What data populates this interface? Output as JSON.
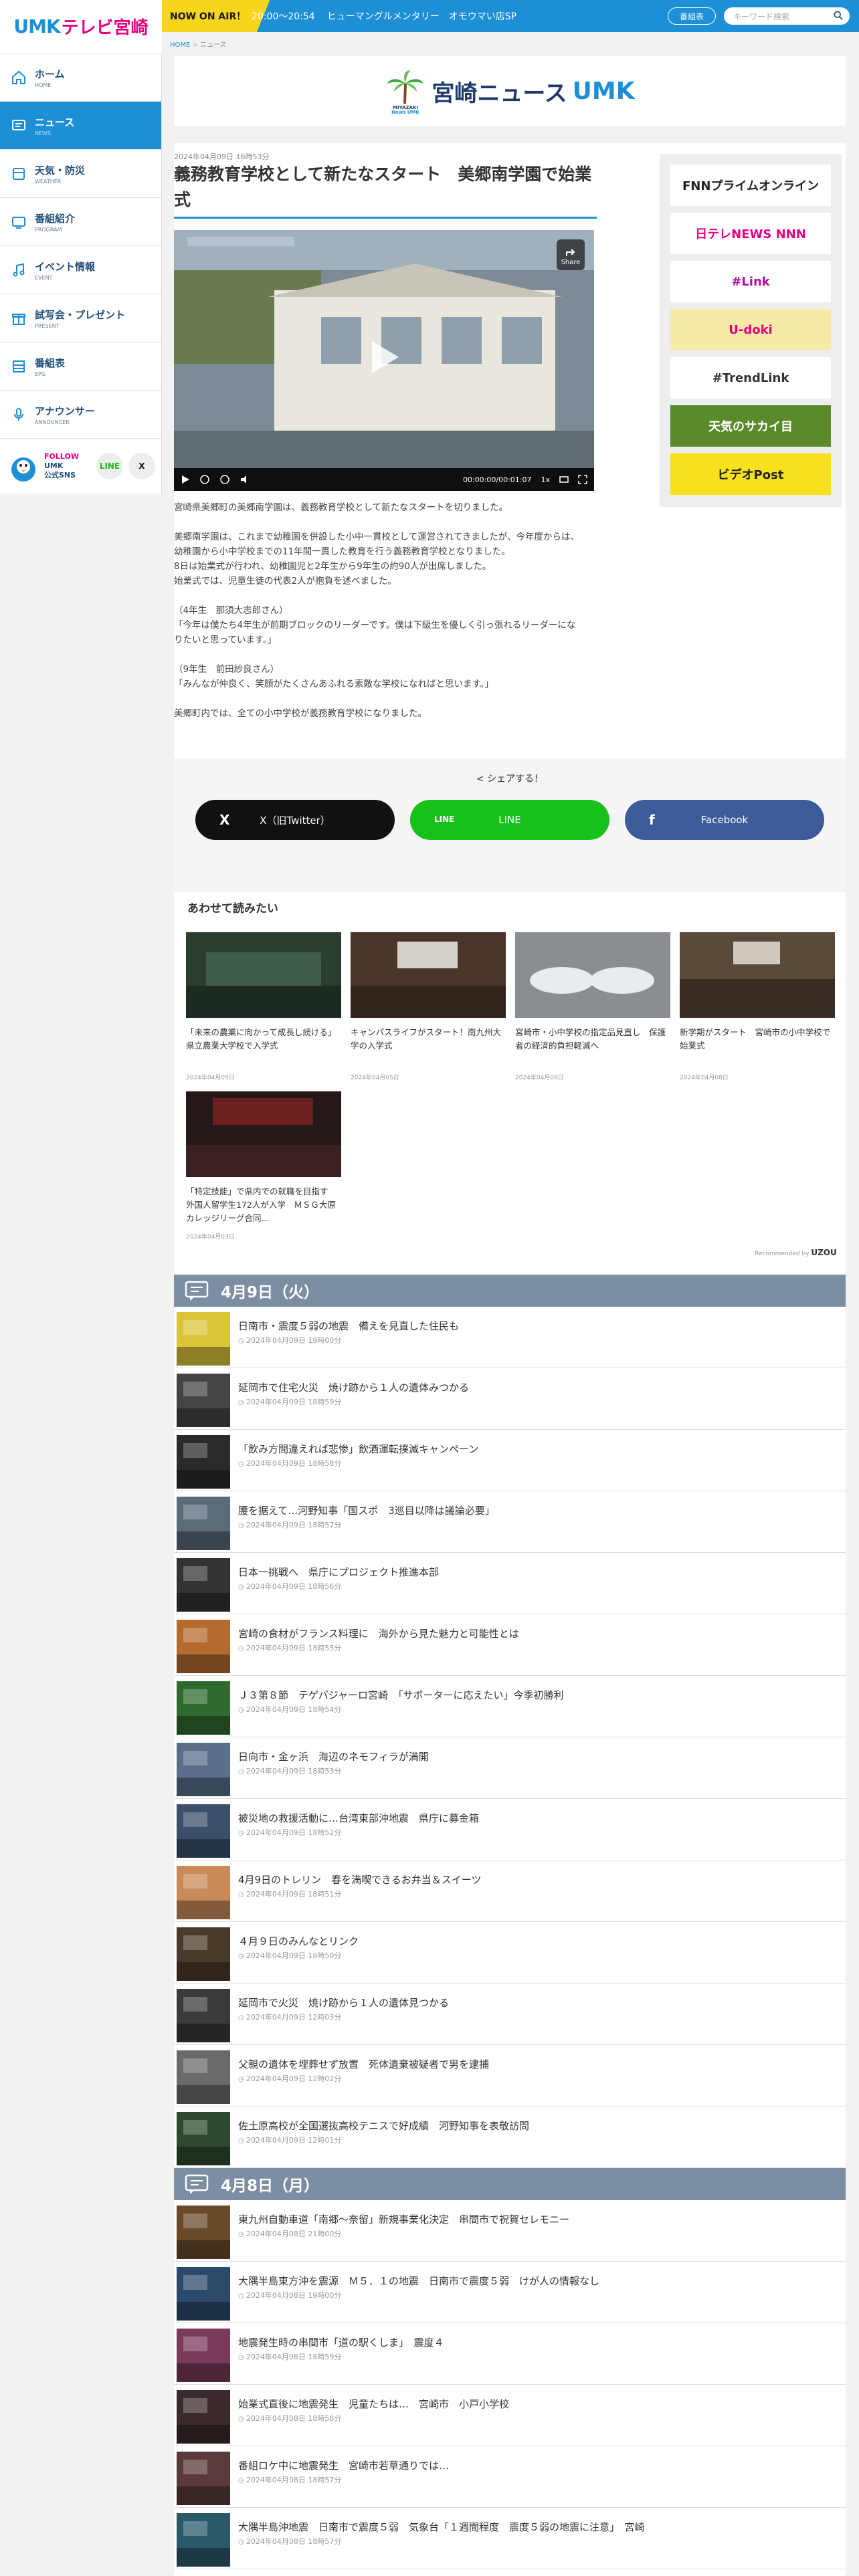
{
  "header": {
    "logo_text": "UMK",
    "logo_sub": "テレビ宮崎",
    "onair_label": "NOW ON AIR！",
    "onair_time": "20:00～20:54",
    "onair_program": "ヒューマングルメンタリー　オモウマい店SP",
    "bangumi_button": "番組表",
    "search_placeholder": "キーワード検索"
  },
  "sidebar": {
    "items": [
      {
        "label": "ホーム",
        "sub": "HOME",
        "icon": "home-icon"
      },
      {
        "label": "ニュース",
        "sub": "NEWS",
        "icon": "news-icon"
      },
      {
        "label": "天気・防災",
        "sub": "WEATHER",
        "icon": "weather-icon"
      },
      {
        "label": "番組紹介",
        "sub": "PROGRAM",
        "icon": "tv-icon"
      },
      {
        "label": "イベント情報",
        "sub": "EVENT",
        "icon": "music-icon"
      },
      {
        "label": "試写会・プレゼント",
        "sub": "PRESENT",
        "icon": "gift-icon"
      },
      {
        "label": "番組表",
        "sub": "EPG",
        "icon": "table-icon"
      },
      {
        "label": "アナウンサー",
        "sub": "ANNOUNCER",
        "icon": "mic-icon"
      }
    ],
    "follow_line1": "FOLLOW",
    "follow_line2": "UMK",
    "follow_line3": "公式SNS",
    "sns": [
      "LINE",
      "X"
    ]
  },
  "breadcrumb": {
    "home": "HOME",
    "sep": ">",
    "current": "ニュース"
  },
  "news_header": {
    "logo_small": "MIYAZAKI News UMK",
    "title": "宮崎ニュース",
    "brand": "UMK"
  },
  "article": {
    "date": "2024年04月09日 16時53分",
    "title": "義務教育学校として新たなスタート　美郷南学園で始業式",
    "video_time": "00:00:00/00:01:07",
    "video_speed": "1x",
    "share_label": "Share",
    "body": [
      "宮崎県美郷町の美郷南学園は、義務教育学校として新たなスタートを切りました。",
      "美郷南学園は、これまで幼稚園を併設した小中一貫校として運営されてきましたが、今年度からは、\n幼稚園から小中学校までの11年間一貫した教育を行う義務教育学校となりました。\n8日は始業式が行われ、幼稚園児と2年生から9年生の約90人が出席しました。\n始業式では、児童生徒の代表2人が抱負を述べました。",
      "（4年生　那須大志郎さん）\n「今年は僕たち4年生が前期ブロックのリーダーです。僕は下級生を優しく引っ張れるリーダーにな\nりたいと思っています。」",
      "（9年生　前田紗良さん）\n「みんなが仲良く、笑顔がたくさんあふれる素敵な学校になればと思います。」",
      "美郷町内では、全ての小中学校が義務教育学校になりました。"
    ]
  },
  "banners": [
    {
      "label": "FNNプライムオンライン",
      "color": "#222222",
      "bg": "#ffffff"
    },
    {
      "label": "日テレNEWS NNN",
      "color": "#e4007f",
      "bg": "#ffffff"
    },
    {
      "label": "#Link",
      "color": "#b40c9c",
      "bg": "#ffffff"
    },
    {
      "label": "U-doki",
      "color": "#e4007f",
      "bg": "#f7e9a8"
    },
    {
      "label": "#TrendLink",
      "color": "#333333",
      "bg": "#ffffff"
    },
    {
      "label": "天気のサカイ目",
      "color": "#ffffff",
      "bg": "#5b8a2a"
    },
    {
      "label": "ビデオPost",
      "color": "#222222",
      "bg": "#f7e11d"
    }
  ],
  "share": {
    "title": "シェアする！",
    "buttons": [
      {
        "label": "X（旧Twitter）",
        "icon": "X",
        "bg": "#111111"
      },
      {
        "label": "LINE",
        "icon": "LINE",
        "bg": "#18c01a"
      },
      {
        "label": "Facebook",
        "icon": "f",
        "bg": "#3c5b9a"
      }
    ]
  },
  "related": {
    "title": "あわせて読みたい",
    "items": [
      {
        "text": "「未来の農業に向かって成長し続ける」県立農業大学校で入学式",
        "date": "2024年04月05日"
      },
      {
        "text": "キャンパスライフがスタート！南九州大学の入学式",
        "date": "2024年04月05日"
      },
      {
        "text": "宮崎市・小中学校の指定品見直し　保護者の経済的負担軽減へ",
        "date": "2024年04月08日"
      },
      {
        "text": "新学期がスタート　宮崎市の小中学校で始業式",
        "date": "2024年04月08日"
      },
      {
        "text": "「特定技能」で県内での就職を目指す　外国人留学生172人が入学　ＭＳＧ大原カレッジリーグ合同...",
        "date": "2024年04月03日"
      }
    ],
    "recommend_label": "Recommended by",
    "recommend_brand": "UZOU"
  },
  "days": [
    {
      "header": "4月9日（火）",
      "rows": [
        {
          "title": "日南市・震度５弱の地震　備えを見直した住民も",
          "date": "2024年04月09日 19時00分"
        },
        {
          "title": "延岡市で住宅火災　焼け跡から１人の遺体みつかる",
          "date": "2024年04月09日 18時59分"
        },
        {
          "title": "「飲み方間違えれば悲惨」飲酒運転撲滅キャンペーン",
          "date": "2024年04月09日 18時58分"
        },
        {
          "title": "腰を据えて…河野知事「国スポ　3巡目以降は議論必要」",
          "date": "2024年04月09日 18時57分"
        },
        {
          "title": "日本一挑戦へ　県庁にプロジェクト推進本部",
          "date": "2024年04月09日 18時56分"
        },
        {
          "title": "宮崎の食材がフランス料理に　海外から見た魅力と可能性とは",
          "date": "2024年04月09日 18時55分"
        },
        {
          "title": "Ｊ３第８節　テゲバジャーロ宮崎　「サポーターに応えたい」今季初勝利",
          "date": "2024年04月09日 18時54分"
        },
        {
          "title": "日向市・金ヶ浜　海辺のネモフィラが満開",
          "date": "2024年04月09日 18時53分"
        },
        {
          "title": "被災地の救援活動に…台湾東部沖地震　県庁に募金箱",
          "date": "2024年04月09日 18時52分"
        },
        {
          "title": "4月9日のトレリン　春を満喫できるお弁当＆スイーツ",
          "date": "2024年04月09日 18時51分"
        },
        {
          "title": "４月９日のみんなとリンク",
          "date": "2024年04月09日 18時50分"
        },
        {
          "title": "延岡市で火災　焼け跡から１人の遺体見つかる",
          "date": "2024年04月09日 12時03分"
        },
        {
          "title": "父親の遺体を埋葬せず放置　死体遺棄被疑者で男を逮捕",
          "date": "2024年04月09日 12時02分"
        },
        {
          "title": "佐土原高校が全国選抜高校テニスで好成績　河野知事を表敬訪問",
          "date": "2024年04月09日 12時01分"
        }
      ]
    },
    {
      "header": "4月8日（月）",
      "rows": [
        {
          "title": "東九州自動車道「南郷～奈留」新規事業化決定　串間市で祝賀セレモニー",
          "date": "2024年04月08日 21時00分"
        },
        {
          "title": "大隅半島東方沖を震源　Ｍ５．１の地震　日南市で震度５弱　けが人の情報なし",
          "date": "2024年04月08日 19時00分"
        },
        {
          "title": "地震発生時の串間市「道の駅くしま」　震度４",
          "date": "2024年04月08日 18時59分"
        },
        {
          "title": "始業式直後に地震発生　児童たちは…　宮崎市　小戸小学校",
          "date": "2024年04月08日 18時58分"
        },
        {
          "title": "番組ロケ中に地震発生　宮崎市若草通りでは…",
          "date": "2024年04月08日 18時57分"
        },
        {
          "title": "大隅半島沖地震　日南市で震度５弱　気象台「１週間程度　震度５弱の地震に注意」　宮崎",
          "date": "2024年04月08日 18時57分"
        }
      ]
    }
  ]
}
